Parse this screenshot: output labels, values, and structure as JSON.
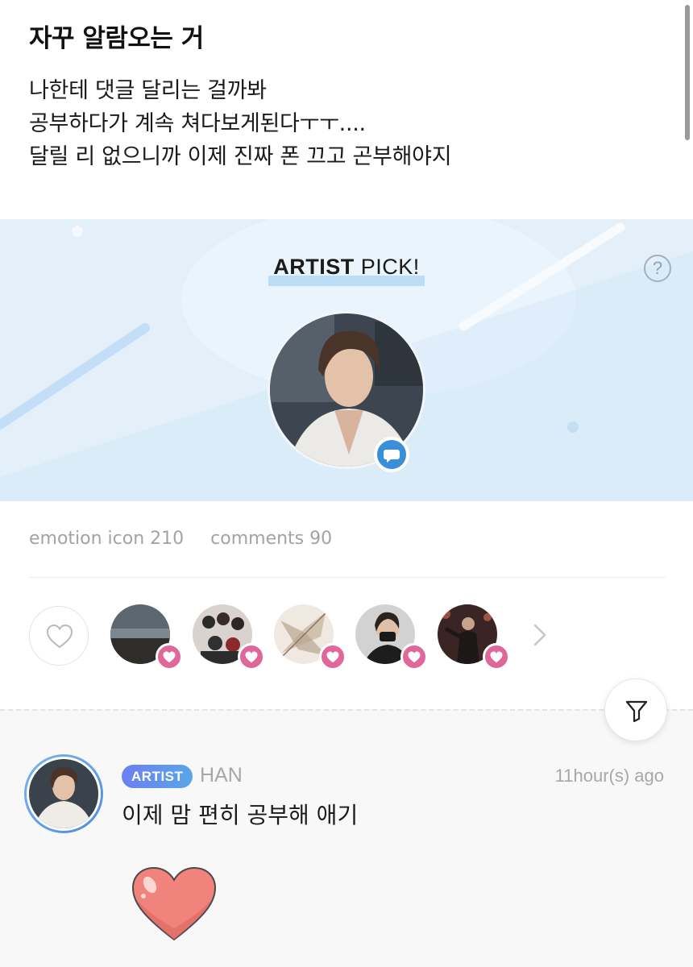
{
  "post": {
    "title": "자꾸 알람오는 거",
    "body_lines": [
      "나한테 댓글 달리는 걸까봐",
      "공부하다가 계속 쳐다보게된다ㅜㅜ....",
      "달릴 리 없으니까 이제 진짜 폰 끄고 곤부해야지"
    ]
  },
  "artist_pick": {
    "title_bold": "ARTIST",
    "title_rest": " PICK!",
    "help_symbol": "?",
    "badge_icon": "chat-bubble-icon",
    "colors": {
      "background": "#e3f0fa",
      "highlight": "#bcdcf5",
      "badge": "#3b8fd8"
    }
  },
  "stats": {
    "emotion": "emotion icon 210",
    "comments": "comments 90"
  },
  "likers": {
    "count_shown": 5,
    "badge_color": "#e0679a",
    "more_icon": "chevron-right-icon"
  },
  "comment": {
    "badge": "ARTIST",
    "name": "HAN",
    "time": "11hour(s) ago",
    "text": "이제 맘 편히 공부해 애기",
    "sticker": "heart-sticker"
  },
  "filter": {
    "icon": "filter-icon"
  }
}
